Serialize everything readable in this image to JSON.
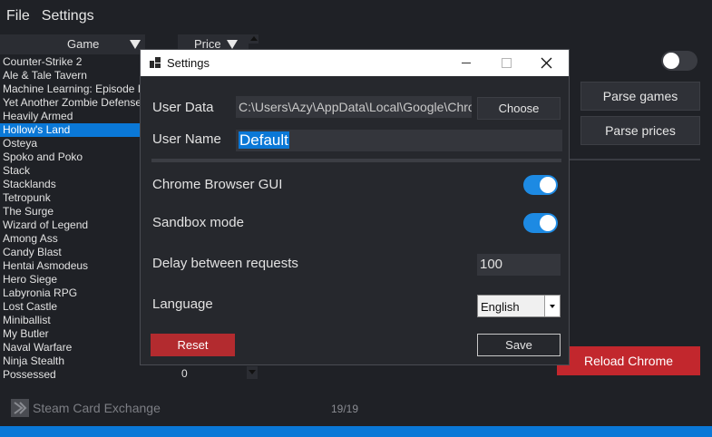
{
  "menu": {
    "file": "File",
    "settings": "Settings"
  },
  "table": {
    "col_game": "Game",
    "col_price": "Price",
    "games": [
      "Counter-Strike 2",
      "Ale & Tale Tavern",
      "Machine Learning: Episode I",
      "Yet Another Zombie Defense",
      "Heavily Armed",
      "Hollow's Land",
      "Osteya",
      "Spoko and Poko",
      "Stack",
      "Stacklands",
      "Tetropunk",
      "The Surge",
      "Wizard of Legend",
      "Among Ass",
      "Candy Blast",
      "Hentai Asmodeus",
      "Hero Siege",
      "Labyronia RPG",
      "Lost Castle",
      "Miniballist",
      "My Butler",
      "Naval Warfare",
      "Ninja Stealth",
      "Possessed"
    ],
    "selected_game": "Hollow's Land",
    "last_price": "0"
  },
  "right_panel": {
    "parse_games": "Parse games",
    "parse_prices": "Parse prices",
    "reload_chrome": "Reload Chrome",
    "toggle_on": false
  },
  "footer": {
    "app_name": "Steam Card Exchange",
    "count": "19/19"
  },
  "dialog": {
    "title": "Settings",
    "user_data_label": "User Data",
    "user_data_value": "C:\\Users\\Azy\\AppData\\Local\\Google\\Chrome",
    "choose_button": "Choose",
    "user_name_label": "User Name",
    "user_name_value": "Default",
    "chrome_gui_label": "Chrome Browser GUI",
    "chrome_gui_on": true,
    "sandbox_label": "Sandbox mode",
    "sandbox_on": true,
    "delay_label": "Delay between requests",
    "delay_value": "100",
    "language_label": "Language",
    "language_value": "English",
    "reset_button": "Reset",
    "save_button": "Save"
  },
  "colors": {
    "background": "#1f2126",
    "accent": "#0a78d7",
    "danger": "#c2272d",
    "toggle_on": "#1d8ae3"
  }
}
